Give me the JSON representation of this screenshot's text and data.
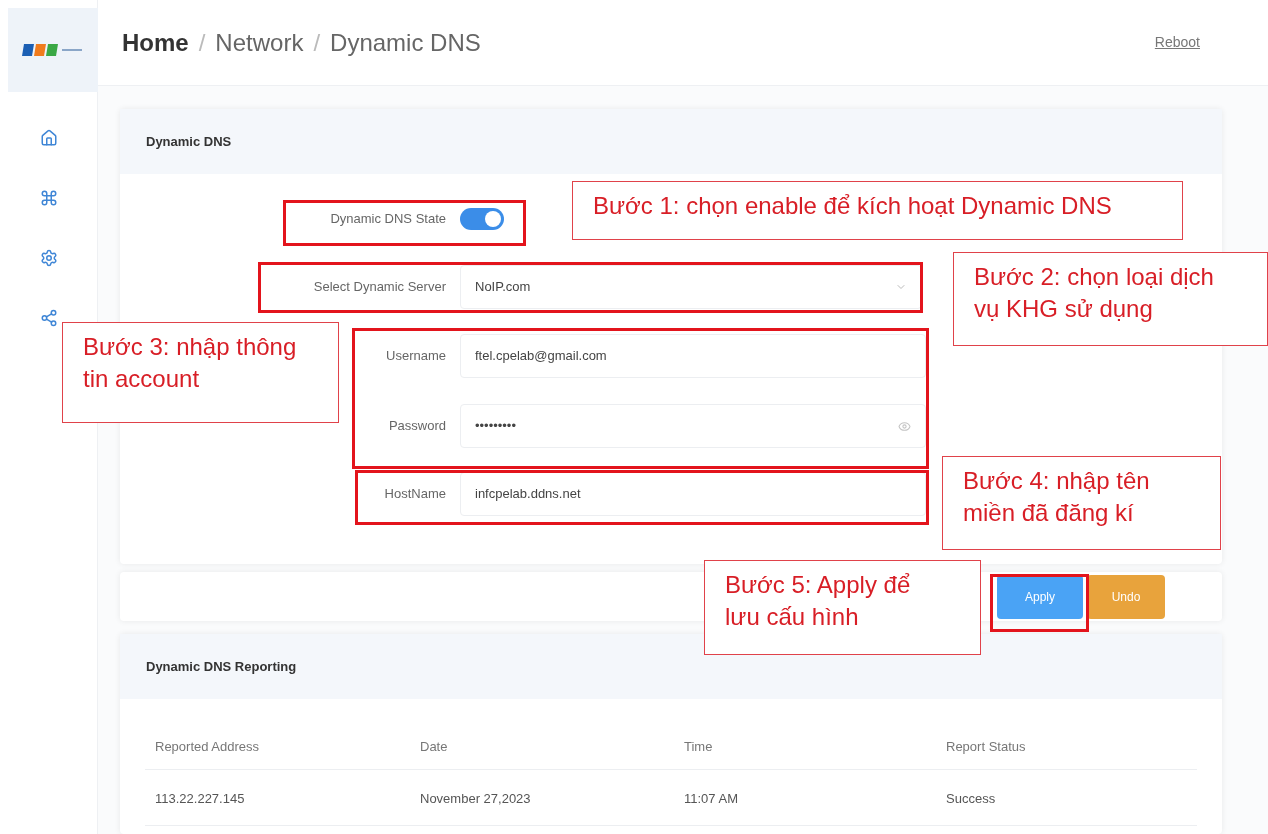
{
  "header": {
    "breadcrumb": [
      {
        "kind": "crumb",
        "label": "Home",
        "emphasized": true
      },
      {
        "kind": "separator",
        "label": "/"
      },
      {
        "kind": "crumb",
        "label": "Network",
        "emphasized": false
      },
      {
        "kind": "separator",
        "label": "/"
      },
      {
        "kind": "crumb",
        "label": "Dynamic DNS",
        "emphasized": false
      }
    ],
    "reboot": "Reboot"
  },
  "settings_card": {
    "title": "Dynamic DNS",
    "rows": [
      {
        "kind": "toggle",
        "label": "Dynamic DNS State",
        "on": true
      },
      {
        "kind": "select",
        "label": "Select Dynamic Server",
        "value": "NoIP.com"
      },
      {
        "kind": "text",
        "label": "Username",
        "value": "ftel.cpelab@gmail.com"
      },
      {
        "kind": "password",
        "label": "Password",
        "value": "•••••••••"
      },
      {
        "kind": "text",
        "label": "HostName",
        "value": "infcpelab.ddns.net"
      }
    ]
  },
  "buttons": [
    {
      "kind": "primary",
      "label": "Apply"
    },
    {
      "kind": "warning",
      "label": "Undo"
    }
  ],
  "reporting": {
    "title": "Dynamic DNS Reporting",
    "columns": [
      "Reported Address",
      "Date",
      "Time",
      "Report Status"
    ],
    "rows": [
      [
        "113.22.227.145",
        "November 27,2023",
        "11:07 AM",
        "Success"
      ]
    ]
  },
  "annotations": [
    {
      "kind": "frame"
    },
    {
      "kind": "callout",
      "text": "Bước 1: chọn enable để kích hoạt Dynamic DNS"
    },
    {
      "kind": "frame"
    },
    {
      "kind": "callout",
      "text": "Bước 2: chọn loại dịch vụ KHG sử dụng"
    },
    {
      "kind": "callout",
      "text": "Bước 3: nhập thông tin account"
    },
    {
      "kind": "frame"
    },
    {
      "kind": "frame"
    },
    {
      "kind": "callout",
      "text": "Bước 4: nhập tên miền đã đăng kí"
    },
    {
      "kind": "callout",
      "text": "Bước 5: Apply để lưu cấu hình"
    },
    {
      "kind": "frame"
    }
  ]
}
